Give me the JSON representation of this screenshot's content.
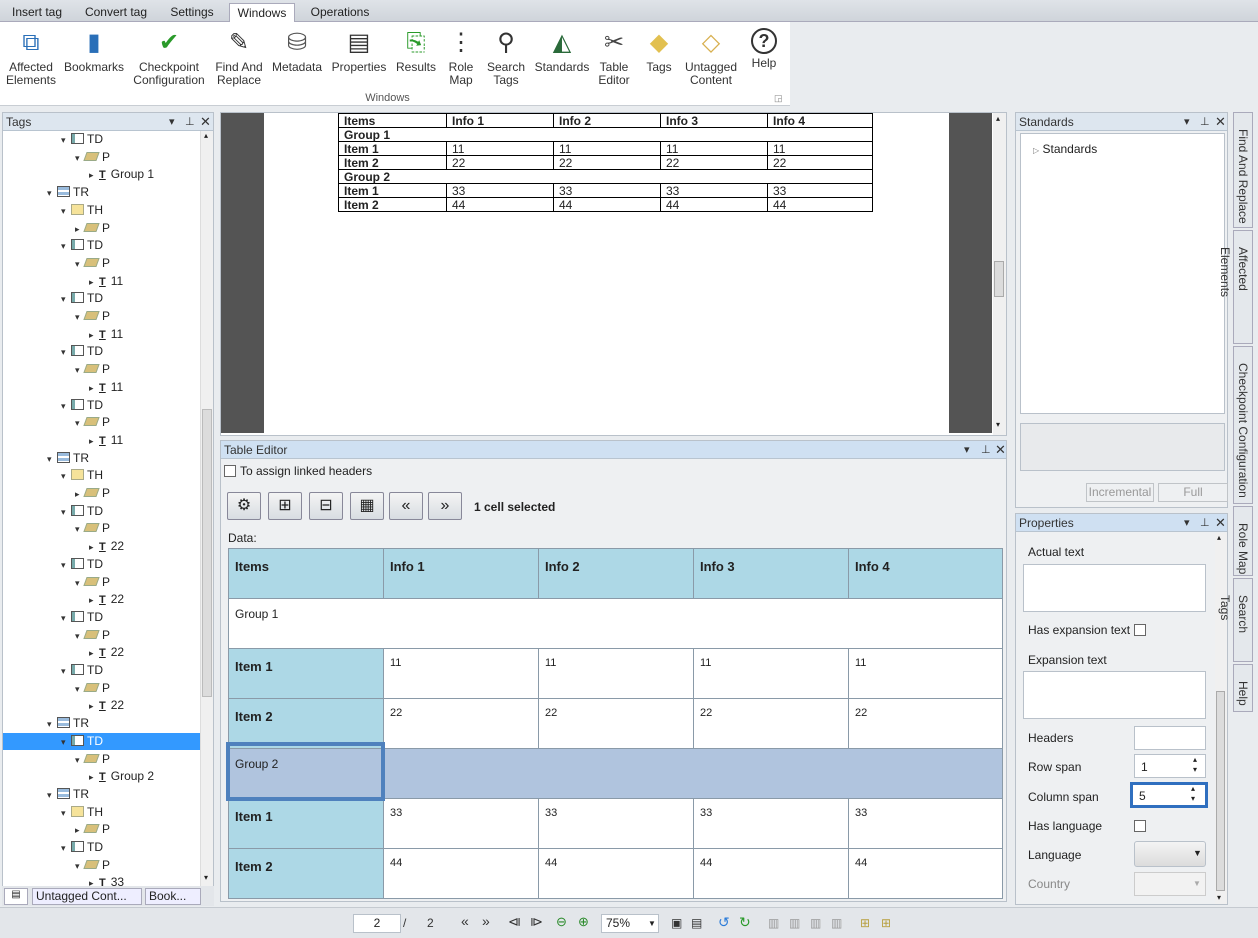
{
  "tabs": [
    "Insert tag",
    "Convert tag",
    "Settings",
    "Windows",
    "Operations"
  ],
  "active_tab": "Windows",
  "ribbon": {
    "buttons": [
      {
        "label1": "Affected",
        "label2": "Elements",
        "icon": "affected-elements-icon"
      },
      {
        "label1": "Bookmarks",
        "label2": "",
        "icon": "bookmarks-icon"
      },
      {
        "label1": "Checkpoint",
        "label2": "Configuration",
        "icon": "checkpoint-icon"
      },
      {
        "label1": "Find And",
        "label2": "Replace",
        "icon": "find-replace-icon"
      },
      {
        "label1": "Metadata",
        "label2": "",
        "icon": "metadata-icon"
      },
      {
        "label1": "Properties",
        "label2": "",
        "icon": "properties-icon"
      },
      {
        "label1": "Results",
        "label2": "",
        "icon": "results-icon"
      },
      {
        "label1": "Role",
        "label2": "Map",
        "icon": "role-map-icon"
      },
      {
        "label1": "Search",
        "label2": "Tags",
        "icon": "search-tags-icon"
      },
      {
        "label1": "Standards",
        "label2": "",
        "icon": "standards-icon"
      },
      {
        "label1": "Table",
        "label2": "Editor",
        "icon": "table-editor-icon"
      },
      {
        "label1": "Tags",
        "label2": "",
        "icon": "tags-icon"
      },
      {
        "label1": "Untagged",
        "label2": "Content",
        "icon": "untagged-content-icon"
      },
      {
        "label1": "Help",
        "label2": "",
        "icon": "help-icon"
      }
    ],
    "group_label": "Windows"
  },
  "tags_panel": {
    "title": "Tags",
    "tree": [
      {
        "depth": 3,
        "type": "TD",
        "label": "TD",
        "arrow": "▾"
      },
      {
        "depth": 4,
        "type": "P",
        "label": "P",
        "arrow": "▾"
      },
      {
        "depth": 5,
        "type": "T",
        "label": "Group 1",
        "arrow": "▸"
      },
      {
        "depth": 2,
        "type": "TR",
        "label": "TR",
        "arrow": "▾"
      },
      {
        "depth": 3,
        "type": "TH",
        "label": "TH",
        "arrow": "▾"
      },
      {
        "depth": 4,
        "type": "P",
        "label": "P",
        "arrow": "▸"
      },
      {
        "depth": 3,
        "type": "TD",
        "label": "TD",
        "arrow": "▾"
      },
      {
        "depth": 4,
        "type": "P",
        "label": "P",
        "arrow": "▾"
      },
      {
        "depth": 5,
        "type": "T",
        "label": "11",
        "arrow": "▸"
      },
      {
        "depth": 3,
        "type": "TD",
        "label": "TD",
        "arrow": "▾"
      },
      {
        "depth": 4,
        "type": "P",
        "label": "P",
        "arrow": "▾"
      },
      {
        "depth": 5,
        "type": "T",
        "label": "11",
        "arrow": "▸"
      },
      {
        "depth": 3,
        "type": "TD",
        "label": "TD",
        "arrow": "▾"
      },
      {
        "depth": 4,
        "type": "P",
        "label": "P",
        "arrow": "▾"
      },
      {
        "depth": 5,
        "type": "T",
        "label": "11",
        "arrow": "▸"
      },
      {
        "depth": 3,
        "type": "TD",
        "label": "TD",
        "arrow": "▾"
      },
      {
        "depth": 4,
        "type": "P",
        "label": "P",
        "arrow": "▾"
      },
      {
        "depth": 5,
        "type": "T",
        "label": "11",
        "arrow": "▸"
      },
      {
        "depth": 2,
        "type": "TR",
        "label": "TR",
        "arrow": "▾"
      },
      {
        "depth": 3,
        "type": "TH",
        "label": "TH",
        "arrow": "▾"
      },
      {
        "depth": 4,
        "type": "P",
        "label": "P",
        "arrow": "▸"
      },
      {
        "depth": 3,
        "type": "TD",
        "label": "TD",
        "arrow": "▾"
      },
      {
        "depth": 4,
        "type": "P",
        "label": "P",
        "arrow": "▾"
      },
      {
        "depth": 5,
        "type": "T",
        "label": "22",
        "arrow": "▸"
      },
      {
        "depth": 3,
        "type": "TD",
        "label": "TD",
        "arrow": "▾"
      },
      {
        "depth": 4,
        "type": "P",
        "label": "P",
        "arrow": "▾"
      },
      {
        "depth": 5,
        "type": "T",
        "label": "22",
        "arrow": "▸"
      },
      {
        "depth": 3,
        "type": "TD",
        "label": "TD",
        "arrow": "▾"
      },
      {
        "depth": 4,
        "type": "P",
        "label": "P",
        "arrow": "▾"
      },
      {
        "depth": 5,
        "type": "T",
        "label": "22",
        "arrow": "▸"
      },
      {
        "depth": 3,
        "type": "TD",
        "label": "TD",
        "arrow": "▾"
      },
      {
        "depth": 4,
        "type": "P",
        "label": "P",
        "arrow": "▾"
      },
      {
        "depth": 5,
        "type": "T",
        "label": "22",
        "arrow": "▸"
      },
      {
        "depth": 2,
        "type": "TR",
        "label": "TR",
        "arrow": "▾"
      },
      {
        "depth": 3,
        "type": "TD",
        "label": "TD",
        "arrow": "▾",
        "selected": true
      },
      {
        "depth": 4,
        "type": "P",
        "label": "P",
        "arrow": "▾"
      },
      {
        "depth": 5,
        "type": "T",
        "label": "Group 2",
        "arrow": "▸"
      },
      {
        "depth": 2,
        "type": "TR",
        "label": "TR",
        "arrow": "▾"
      },
      {
        "depth": 3,
        "type": "TH",
        "label": "TH",
        "arrow": "▾"
      },
      {
        "depth": 4,
        "type": "P",
        "label": "P",
        "arrow": "▸"
      },
      {
        "depth": 3,
        "type": "TD",
        "label": "TD",
        "arrow": "▾"
      },
      {
        "depth": 4,
        "type": "P",
        "label": "P",
        "arrow": "▾"
      },
      {
        "depth": 5,
        "type": "T",
        "label": "33",
        "arrow": "▸"
      }
    ],
    "bottom_tabs": [
      "Untagged Cont...",
      "Book..."
    ]
  },
  "document": {
    "rows": [
      {
        "cells": [
          "Items",
          "Info 1",
          "Info 2",
          "Info 3",
          "Info 4"
        ],
        "bold": true
      },
      {
        "cells": [
          "Group 1"
        ],
        "bold": true,
        "span": true
      },
      {
        "cells": [
          "Item 1",
          "11",
          "11",
          "11",
          "11"
        ],
        "boldfirst": true
      },
      {
        "cells": [
          "Item 2",
          "22",
          "22",
          "22",
          "22"
        ],
        "boldfirst": true
      },
      {
        "cells": [
          "Group 2"
        ],
        "bold": true,
        "span": true
      },
      {
        "cells": [
          "Item 1",
          "33",
          "33",
          "33",
          "33"
        ],
        "boldfirst": true
      },
      {
        "cells": [
          "Item 2",
          "44",
          "44",
          "44",
          "44"
        ],
        "boldfirst": true
      }
    ]
  },
  "table_editor": {
    "title": "Table Editor",
    "linked_headers_label": "To assign linked headers",
    "status": "1 cell selected",
    "data_label": "Data:",
    "headers": [
      "Items",
      "Info 1",
      "Info 2",
      "Info 3",
      "Info 4"
    ],
    "group1": "Group 1",
    "group2": "Group 2",
    "rows_a": [
      {
        "name": "Item 1",
        "values": [
          "11",
          "11",
          "11",
          "11"
        ]
      },
      {
        "name": "Item 2",
        "values": [
          "22",
          "22",
          "22",
          "22"
        ]
      }
    ],
    "rows_b": [
      {
        "name": "Item 1",
        "values": [
          "33",
          "33",
          "33",
          "33"
        ]
      },
      {
        "name": "Item 2",
        "values": [
          "44",
          "44",
          "44",
          "44"
        ]
      }
    ]
  },
  "standards_panel": {
    "title": "Standards",
    "root": "Standards",
    "incremental_label": "Incremental",
    "full_label": "Full"
  },
  "properties_panel": {
    "title": "Properties",
    "actual_text_label": "Actual text",
    "has_expansion_label": "Has expansion text",
    "expansion_label": "Expansion text",
    "headers_label": "Headers",
    "row_span_label": "Row span",
    "row_span_value": "1",
    "col_span_label": "Column span",
    "col_span_value": "5",
    "has_language_label": "Has language",
    "language_label": "Language",
    "country_label": "Country"
  },
  "vertical_tabs": [
    "Find And Replace",
    "Affected Elements",
    "Checkpoint Configuration",
    "Role Map",
    "Search Tags",
    "Help"
  ],
  "statusbar": {
    "page_current": "2",
    "page_sep": "/",
    "page_total": "2",
    "zoom": "75%"
  },
  "colors": {
    "header_cell": "#add8e6",
    "selected_row": "#b0c4de",
    "selection_border": "#4f81bd",
    "tree_selection": "#3399ff"
  }
}
